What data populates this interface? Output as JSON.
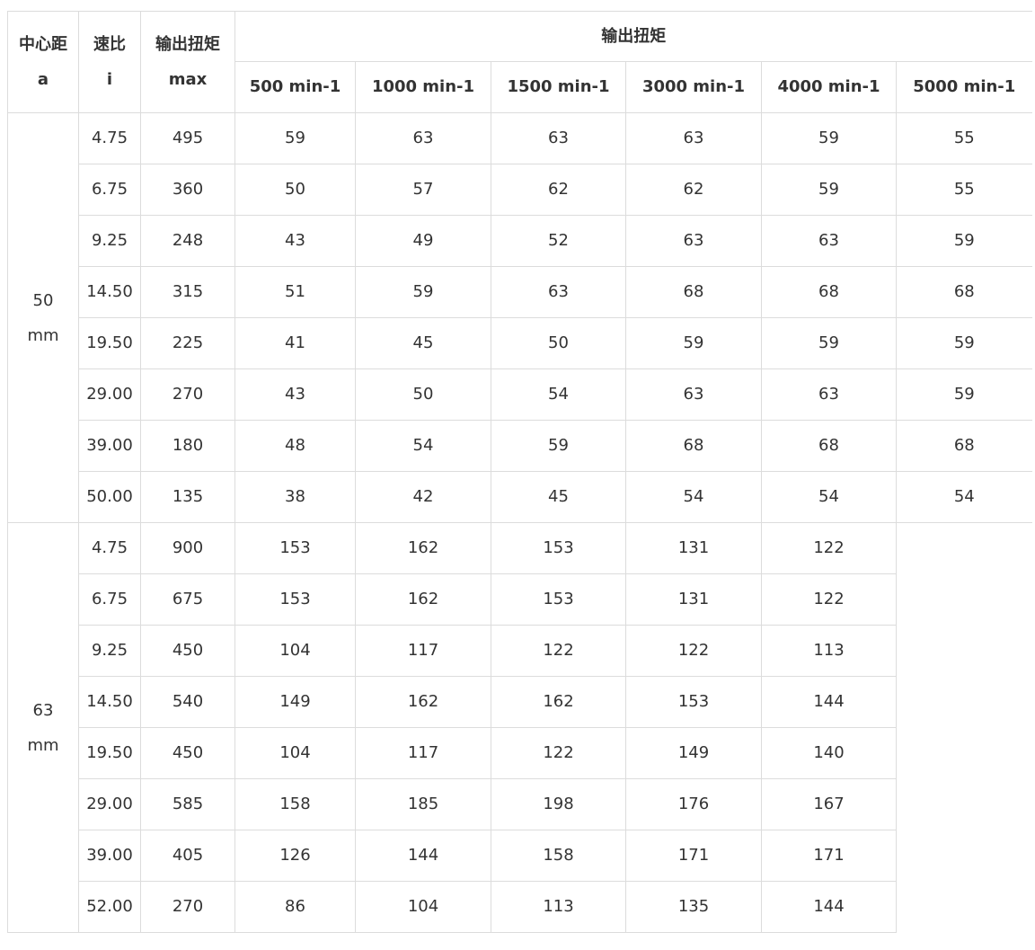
{
  "table": {
    "headers": {
      "center_distance": [
        "中心距",
        "a"
      ],
      "ratio": [
        "速比",
        "i"
      ],
      "max_torque": [
        "输出扭矩",
        "max"
      ],
      "torque_group": "输出扭矩",
      "speeds": [
        "500 min-1",
        "1000 min-1",
        "1500 min-1",
        "3000 min-1",
        "4000 min-1",
        "5000 min-1"
      ]
    },
    "groups": [
      {
        "center_distance": [
          "50",
          "mm"
        ],
        "rows": [
          {
            "i": "4.75",
            "max": "495",
            "values": [
              "59",
              "63",
              "63",
              "63",
              "59",
              "55"
            ]
          },
          {
            "i": "6.75",
            "max": "360",
            "values": [
              "50",
              "57",
              "62",
              "62",
              "59",
              "55"
            ]
          },
          {
            "i": "9.25",
            "max": "248",
            "values": [
              "43",
              "49",
              "52",
              "63",
              "63",
              "59"
            ]
          },
          {
            "i": "14.50",
            "max": "315",
            "values": [
              "51",
              "59",
              "63",
              "68",
              "68",
              "68"
            ]
          },
          {
            "i": "19.50",
            "max": "225",
            "values": [
              "41",
              "45",
              "50",
              "59",
              "59",
              "59"
            ]
          },
          {
            "i": "29.00",
            "max": "270",
            "values": [
              "43",
              "50",
              "54",
              "63",
              "63",
              "59"
            ]
          },
          {
            "i": "39.00",
            "max": "180",
            "values": [
              "48",
              "54",
              "59",
              "68",
              "68",
              "68"
            ]
          },
          {
            "i": "50.00",
            "max": "135",
            "values": [
              "38",
              "42",
              "45",
              "54",
              "54",
              "54"
            ]
          }
        ]
      },
      {
        "center_distance": [
          "63",
          "mm"
        ],
        "rows": [
          {
            "i": "4.75",
            "max": "900",
            "values": [
              "153",
              "162",
              "153",
              "131",
              "122"
            ]
          },
          {
            "i": "6.75",
            "max": "675",
            "values": [
              "153",
              "162",
              "153",
              "131",
              "122"
            ]
          },
          {
            "i": "9.25",
            "max": "450",
            "values": [
              "104",
              "117",
              "122",
              "122",
              "113"
            ]
          },
          {
            "i": "14.50",
            "max": "540",
            "values": [
              "149",
              "162",
              "162",
              "153",
              "144"
            ]
          },
          {
            "i": "19.50",
            "max": "450",
            "values": [
              "104",
              "117",
              "122",
              "149",
              "140"
            ]
          },
          {
            "i": "29.00",
            "max": "585",
            "values": [
              "158",
              "185",
              "198",
              "176",
              "167"
            ]
          },
          {
            "i": "39.00",
            "max": "405",
            "values": [
              "126",
              "144",
              "158",
              "171",
              "171"
            ]
          },
          {
            "i": "52.00",
            "max": "270",
            "values": [
              "86",
              "104",
              "113",
              "135",
              "144"
            ]
          }
        ]
      }
    ]
  }
}
